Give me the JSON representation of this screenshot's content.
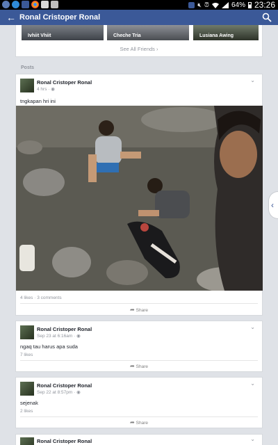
{
  "status_bar": {
    "notification_icons": [
      "64-badge-icon",
      "messenger-icon",
      "facebook-icon",
      "chrome-icon",
      "gallery-icon",
      "screenshot-icon"
    ],
    "right_icons": [
      "facebook-icon",
      "mute-icon",
      "alarm-icon",
      "wifi-icon",
      "signal-icon"
    ],
    "battery": "64%",
    "time": "23:26"
  },
  "app_bar": {
    "title": "Ronal Cristoper Ronal",
    "color": "#3b5998"
  },
  "friends": {
    "names": [
      "Ivhiit Vhiit",
      "Cheche Tria",
      "Lusiana Awing"
    ],
    "see_all": "See All Friends"
  },
  "posts_label": "Posts",
  "posts": [
    {
      "author": "Ronal Cristoper Ronal",
      "time": "4 hrs",
      "text": "tngkapan hri ini",
      "stats": "4 likes · 3 comments",
      "share": "Share"
    },
    {
      "author": "Ronal Cristoper Ronal",
      "time": "Sep 23 at 6:16am",
      "text": "ngaq tau harus apa suda",
      "stats": "7 likes",
      "share": "Share"
    },
    {
      "author": "Ronal Cristoper Ronal",
      "time": "Sep 22 at 8:57pm",
      "text": "sejenak",
      "stats": "2 likes",
      "share": "Share"
    },
    {
      "author": "Ronal Cristoper Ronal"
    }
  ]
}
